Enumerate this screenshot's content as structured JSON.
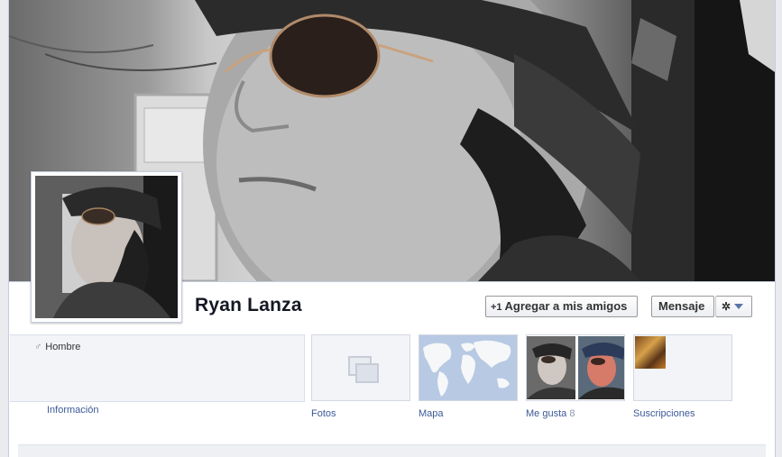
{
  "profile": {
    "name": "Ryan Lanza"
  },
  "actions": {
    "add_friend_icon": "+1",
    "add_friend_label": "Agregar a mis amigos",
    "message_label": "Mensaje",
    "gear_icon": "✲"
  },
  "about": {
    "gender_symbol": "♂",
    "gender": "Hombre",
    "label": "Información"
  },
  "tabs": {
    "photos_label": "Fotos",
    "map_label": "Mapa",
    "likes_label": "Me gusta",
    "likes_count": "8",
    "subscriptions_label": "Suscripciones"
  },
  "colors": {
    "link": "#3b5998",
    "name": "#141823",
    "tile_bg": "#f2f4f8",
    "map_water": "#b7c9e3"
  },
  "icons": {
    "photos": "photos-stack-icon",
    "gear": "gear-icon",
    "dropdown": "caret-down-icon",
    "add_friend": "add-friend-icon"
  }
}
